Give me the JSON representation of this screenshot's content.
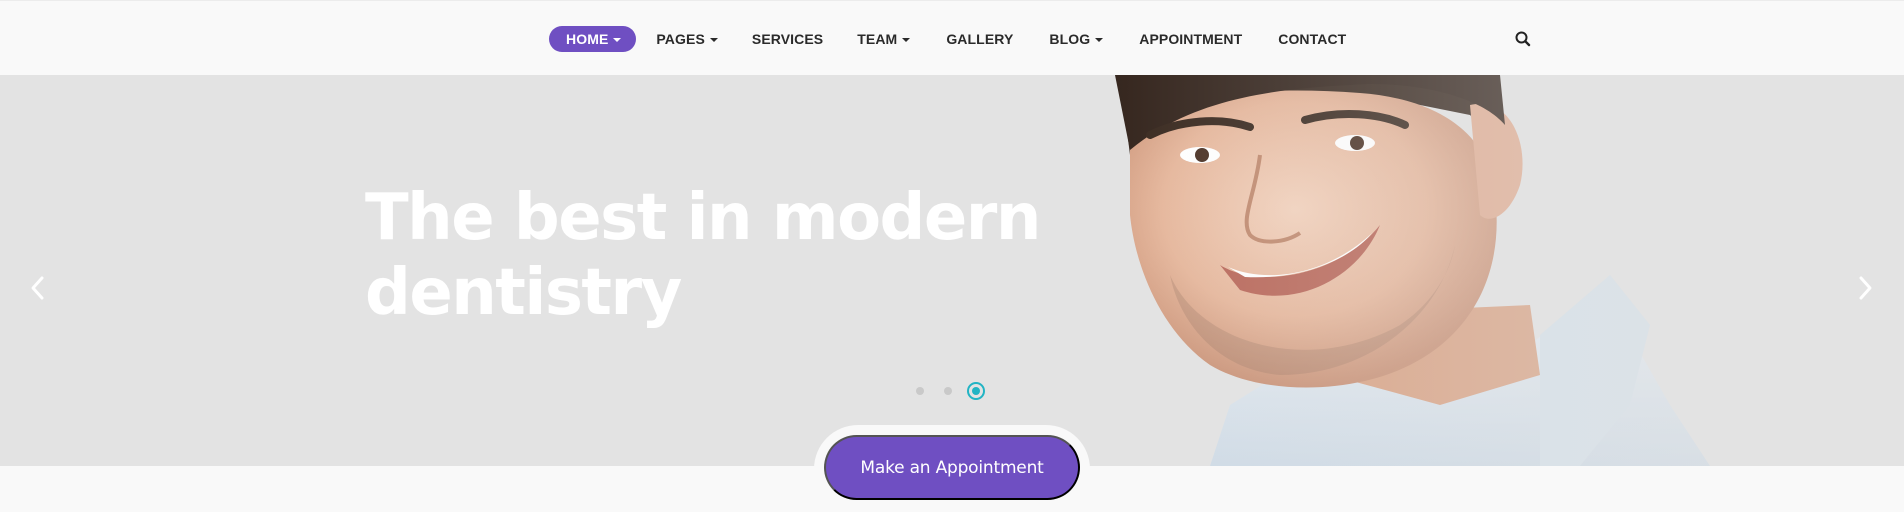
{
  "nav": {
    "items": [
      {
        "label": "HOME",
        "dropdown": true,
        "active": true
      },
      {
        "label": "PAGES",
        "dropdown": true
      },
      {
        "label": "SERVICES",
        "dropdown": false
      },
      {
        "label": "TEAM",
        "dropdown": true
      },
      {
        "label": "GALLERY",
        "dropdown": false
      },
      {
        "label": "BLOG",
        "dropdown": true
      },
      {
        "label": "APPOINTMENT",
        "dropdown": false
      },
      {
        "label": "CONTACT",
        "dropdown": false
      }
    ],
    "search_icon": "search-icon"
  },
  "hero": {
    "title_line1": "The best in modern",
    "title_line2": "dentistry",
    "slider": {
      "total_slides": 3,
      "active_slide": 3
    },
    "prev_icon": "chevron-left-icon",
    "next_icon": "chevron-right-icon"
  },
  "cta": {
    "label": "Make an Appointment"
  },
  "colors": {
    "accent": "#6f4fc2",
    "slider_active": "#22b4c4",
    "hero_bg": "#e3e3e3",
    "page_bg": "#f9f9f9",
    "nav_text": "#2a2a2a"
  }
}
